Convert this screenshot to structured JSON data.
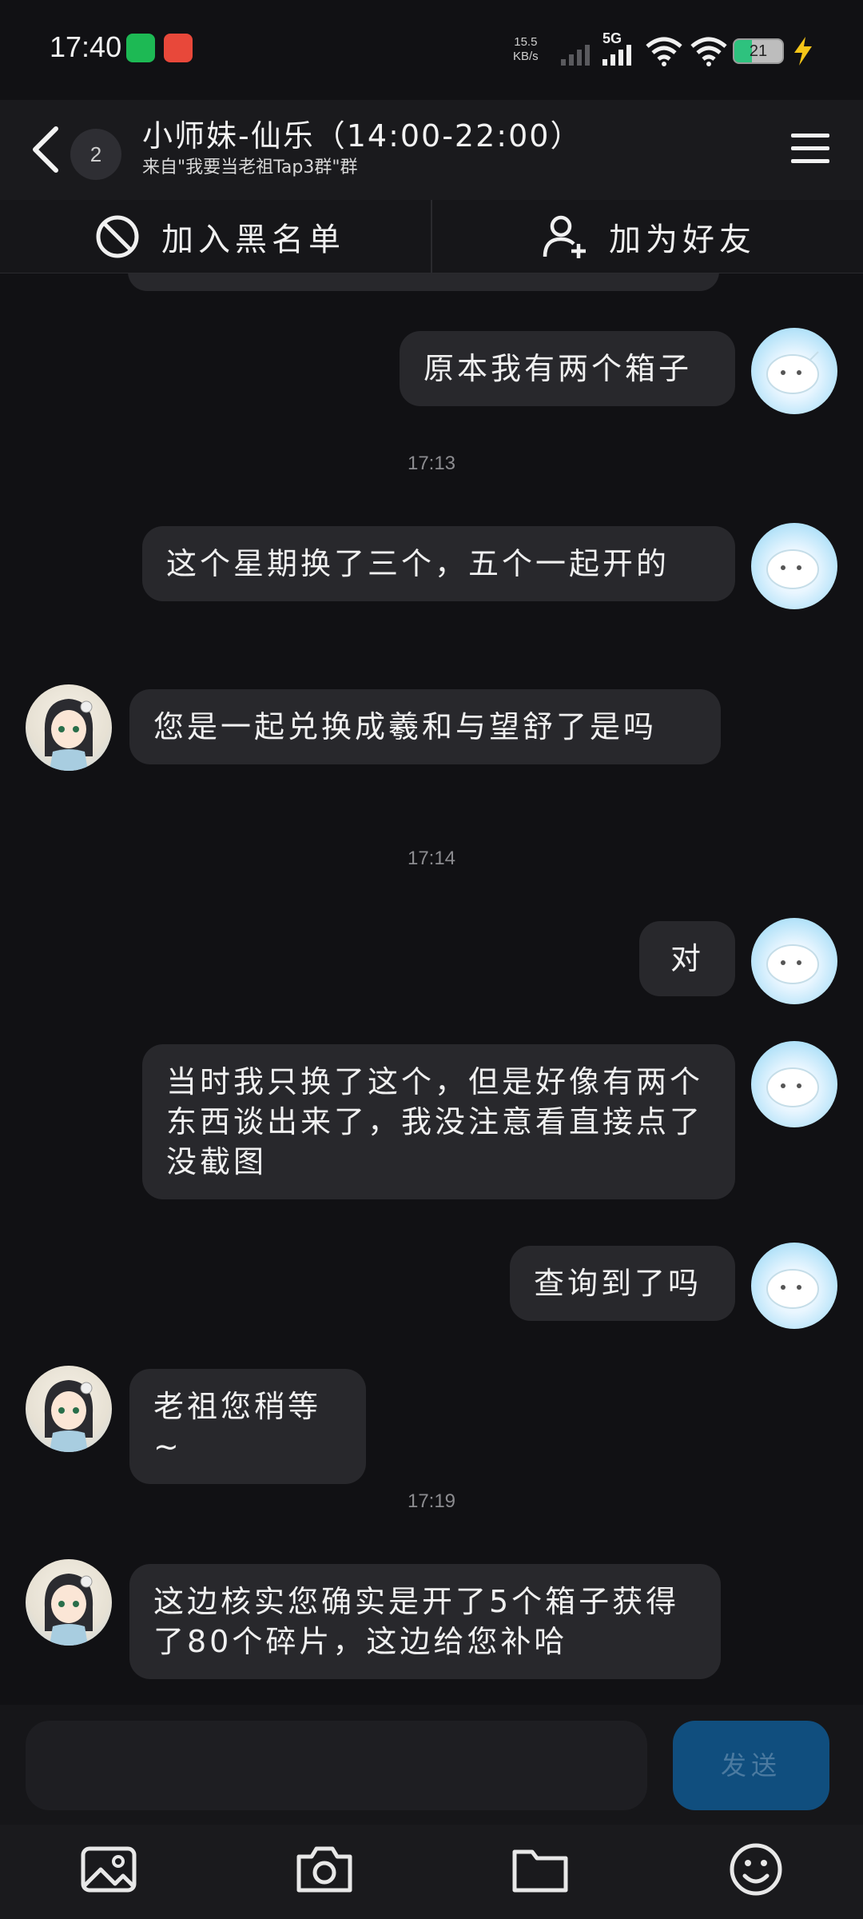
{
  "status_bar": {
    "time": "17:40",
    "net_speed_value": "15.5",
    "net_speed_unit": "KB/s",
    "network_type": "5G",
    "battery_level": "21"
  },
  "header": {
    "unread_count": "2",
    "title": "小师妹-仙乐（14:00-22:00）",
    "subtitle": "来自\"我要当老祖Tap3群\"群"
  },
  "actions": {
    "block_label": "加入黑名单",
    "add_friend_label": "加为好友"
  },
  "messages": [
    {
      "side": "right",
      "text": "原本我有两个箱子"
    },
    {
      "type": "time",
      "text": "17:13"
    },
    {
      "side": "right",
      "text": "这个星期换了三个，五个一起开的"
    },
    {
      "side": "left",
      "text": "您是一起兑换成羲和与望舒了是吗"
    },
    {
      "type": "time",
      "text": "17:14"
    },
    {
      "side": "right",
      "text": "对"
    },
    {
      "side": "right",
      "text": "当时我只换了这个，但是好像有两个东西谈出来了，我没注意看直接点了没截图"
    },
    {
      "side": "right",
      "text": "查询到了吗"
    },
    {
      "side": "left",
      "text": "老祖您稍等~"
    },
    {
      "type": "time",
      "text": "17:19"
    },
    {
      "side": "left",
      "text": "这边核实您确实是开了5个箱子获得了80个碎片，这边给您补哈"
    }
  ],
  "input": {
    "value": "",
    "placeholder": "",
    "send_label": "发送"
  },
  "toolbar": {
    "icons": [
      "image-icon",
      "camera-icon",
      "folder-icon",
      "emoji-icon"
    ]
  },
  "colors": {
    "background": "#111114",
    "bubble": "#28282c",
    "send_button": "#104e7e",
    "battery_fill": "#2ec27e",
    "charging_bolt": "#f5c518"
  }
}
